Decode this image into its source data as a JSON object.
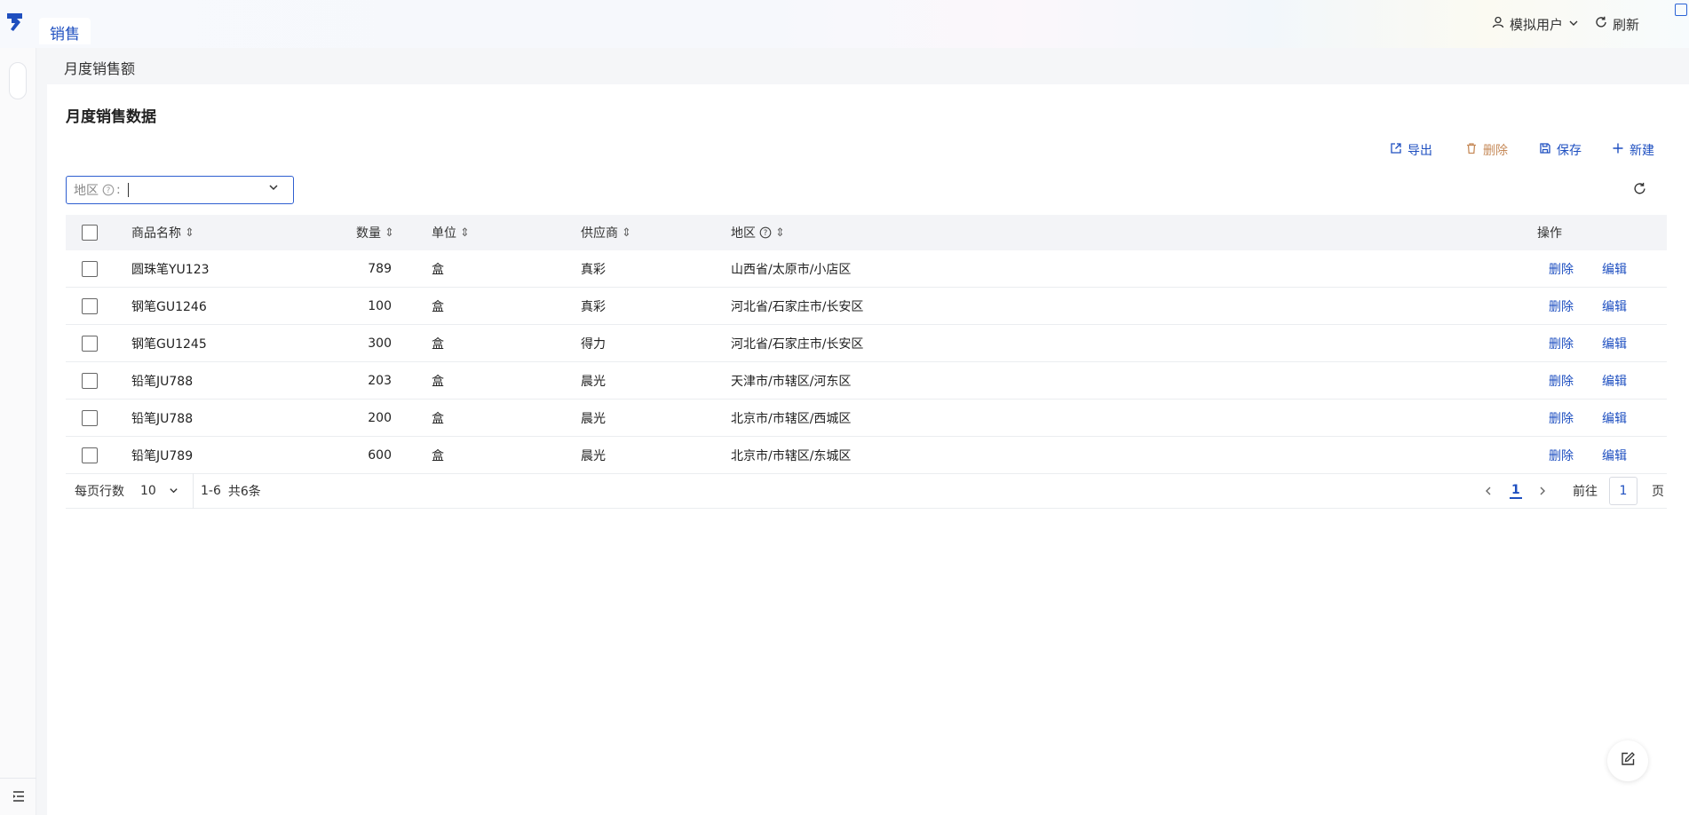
{
  "app": {
    "tab": "销售"
  },
  "header": {
    "user": "模拟用户",
    "refresh": "刷新"
  },
  "breadcrumb": "月度销售额",
  "panel": {
    "title": "月度销售数据",
    "toolbar": {
      "export": "导出",
      "delete": "删除",
      "save": "保存",
      "create": "新建"
    },
    "filter": {
      "label": "地区",
      "help": "?",
      "colon": ":",
      "value": ""
    }
  },
  "table": {
    "headers": {
      "name": "商品名称",
      "qty": "数量",
      "unit": "单位",
      "supplier": "供应商",
      "region": "地区",
      "ops": "操作"
    },
    "rows": [
      {
        "name": "圆珠笔YU123",
        "qty": "789",
        "unit": "盒",
        "supplier": "真彩",
        "region": "山西省/太原市/小店区",
        "del": "删除",
        "edit": "编辑"
      },
      {
        "name": "钢笔GU1246",
        "qty": "100",
        "unit": "盒",
        "supplier": "真彩",
        "region": "河北省/石家庄市/长安区",
        "del": "删除",
        "edit": "编辑"
      },
      {
        "name": "钢笔GU1245",
        "qty": "300",
        "unit": "盒",
        "supplier": "得力",
        "region": "河北省/石家庄市/长安区",
        "del": "删除",
        "edit": "编辑"
      },
      {
        "name": "铅笔JU788",
        "qty": "203",
        "unit": "盒",
        "supplier": "晨光",
        "region": "天津市/市辖区/河东区",
        "del": "删除",
        "edit": "编辑"
      },
      {
        "name": "铅笔JU788",
        "qty": "200",
        "unit": "盒",
        "supplier": "晨光",
        "region": "北京市/市辖区/西城区",
        "del": "删除",
        "edit": "编辑"
      },
      {
        "name": "铅笔JU789",
        "qty": "600",
        "unit": "盒",
        "supplier": "晨光",
        "region": "北京市/市辖区/东城区",
        "del": "删除",
        "edit": "编辑"
      }
    ]
  },
  "pager": {
    "rows_per_page_label": "每页行数",
    "rows_per_page": "10",
    "range": "1-6",
    "total": "共6条",
    "current_page": "1",
    "goto_label": "前往",
    "goto_value": "1",
    "page_suffix": "页"
  }
}
